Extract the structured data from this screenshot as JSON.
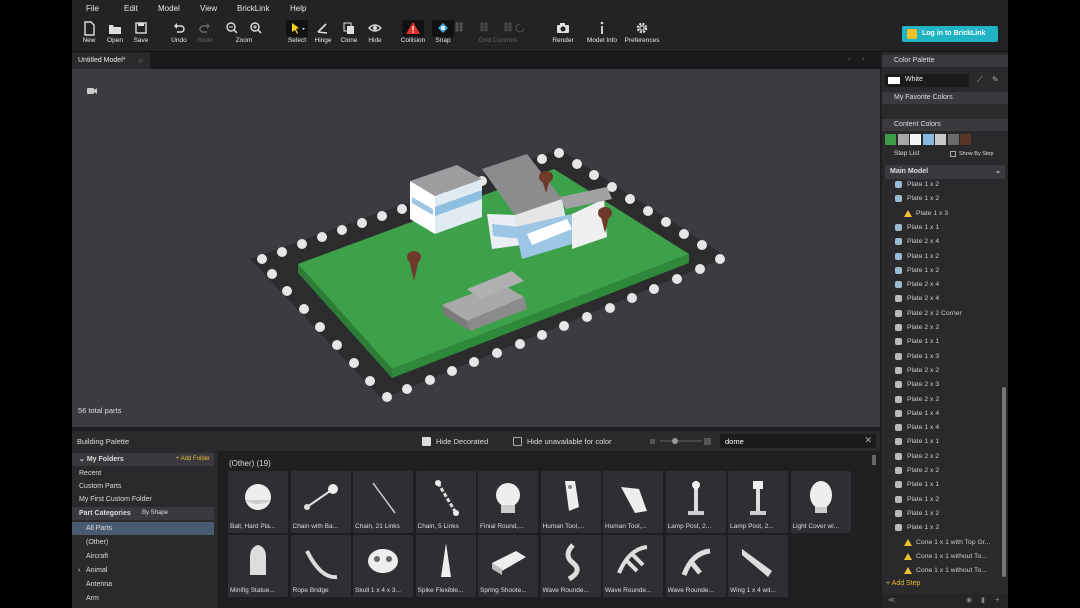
{
  "menu": [
    "File",
    "Edit",
    "Model",
    "View",
    "BrickLink",
    "Help"
  ],
  "toolbar": {
    "new": "New",
    "open": "Open",
    "save": "Save",
    "undo": "Undo",
    "redo": "Redo",
    "zoom": "Zoom",
    "select": "Select",
    "hinge": "Hinge",
    "clone": "Clone",
    "hide": "Hide",
    "collision": "Collision",
    "snap": "Snap",
    "grid_controls": "Grid Controls",
    "render": "Render",
    "model_info": "Model Info",
    "preferences": "Preferences",
    "login": "Log in to BrickLink"
  },
  "tab": {
    "label": "Untitled Model*"
  },
  "viewport": {
    "total_parts": "56 total parts"
  },
  "palette": {
    "title": "Building Palette",
    "hide_decorated": "Hide Decorated",
    "hide_decorated_checked": true,
    "hide_unavailable": "Hide unavailable for color",
    "search_value": "dome",
    "group_label": "(Other) (19)",
    "my_folders": "My Folders",
    "add_folder": "+ Add Folder",
    "recent": "Recent",
    "custom_parts": "Custom Parts",
    "first_folder": "My First Custom Folder",
    "part_categories": "Part Categories",
    "by_shape": "By Shape",
    "categories": [
      "All Parts",
      "(Other)",
      "Aircraft",
      "Animal",
      "Antenna",
      "Arm"
    ],
    "parts": [
      "Ball, Hard Pla...",
      "Chain with Ba...",
      "Chain, 21 Links",
      "Chain, 5 Links",
      "Finial Round,...",
      "Human Tool,...",
      "Human Tool,...",
      "Lamp Post, 2...",
      "Lamp Post, 2...",
      "Light Cover wi...",
      "Minifig Statue...",
      "Rope Bridge",
      "Skull 1 x 4 x 3...",
      "Spike Flexible...",
      "Spring Shoote...",
      "Wave Rounde...",
      "Wave Rounde...",
      "Wave Rounde...",
      "Wing 1 x 4 wit..."
    ]
  },
  "color_panel": {
    "title": "Color Palette",
    "selected": "White",
    "favorites": "My Favorite Colors",
    "content": "Content Colors",
    "content_swatches": [
      "#3f9a4a",
      "#a8a8a8",
      "#f5f5f5",
      "#86b8dc",
      "#c8c8c8",
      "#6a6a6a",
      "#5a3428"
    ]
  },
  "step_list": {
    "title": "Step List",
    "show_by_step": "Show By Step",
    "model": "Main Model",
    "steps": [
      {
        "label": "Plate 1 x 2",
        "icon": "blue"
      },
      {
        "label": "Plate 1 x 2",
        "icon": "blue"
      },
      {
        "label": "Plate 1 x 3",
        "icon": "warn"
      },
      {
        "label": "Plate 1 x 1",
        "icon": "blue"
      },
      {
        "label": "Plate 2 x 4",
        "icon": "blue"
      },
      {
        "label": "Plate 1 x 2",
        "icon": "blue"
      },
      {
        "label": "Plate 1 x 2",
        "icon": "blue"
      },
      {
        "label": "Plate 2 x 4",
        "icon": "blue"
      },
      {
        "label": "Plate 2 x 4",
        "icon": "gray"
      },
      {
        "label": "Plate 2 x 2 Corner",
        "icon": "gray"
      },
      {
        "label": "Plate 2 x 2",
        "icon": "gray"
      },
      {
        "label": "Plate 1 x 1",
        "icon": "gray"
      },
      {
        "label": "Plate 1 x 3",
        "icon": "gray"
      },
      {
        "label": "Plate 2 x 2",
        "icon": "gray"
      },
      {
        "label": "Plate 2 x 3",
        "icon": "gray"
      },
      {
        "label": "Plate 2 x 2",
        "icon": "gray"
      },
      {
        "label": "Plate 1 x 4",
        "icon": "gray"
      },
      {
        "label": "Plate 1 x 4",
        "icon": "gray"
      },
      {
        "label": "Plate 1 x 1",
        "icon": "gray"
      },
      {
        "label": "Plate 2 x 2",
        "icon": "gray"
      },
      {
        "label": "Plate 2 x 2",
        "icon": "gray"
      },
      {
        "label": "Plate 1 x 1",
        "icon": "gray"
      },
      {
        "label": "Plate 1 x 2",
        "icon": "gray"
      },
      {
        "label": "Plate 1 x 2",
        "icon": "gray"
      },
      {
        "label": "Plate 1 x 2",
        "icon": "gray"
      },
      {
        "label": "Cone 1 x 1 with Top Gr...",
        "icon": "warn"
      },
      {
        "label": "Cone 1 x 1 without To...",
        "icon": "warn"
      },
      {
        "label": "Cone 1 x 1 without To...",
        "icon": "warn"
      }
    ],
    "add_step": "+ Add Step"
  }
}
